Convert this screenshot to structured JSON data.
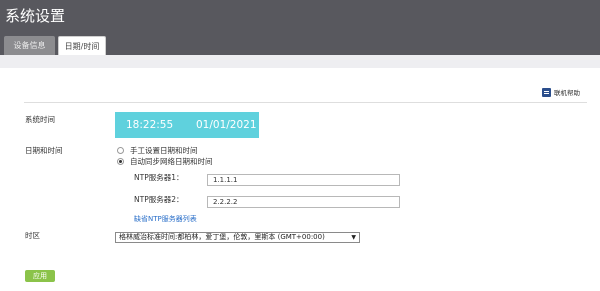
{
  "app": {
    "title": "系统设置"
  },
  "tabs": [
    {
      "label": "设备信息",
      "active": false
    },
    {
      "label": "日期/时间",
      "active": true
    }
  ],
  "help": {
    "label": "联机帮助",
    "icon": "help-book-icon"
  },
  "system_time": {
    "label": "系统时间",
    "time": "18:22:55",
    "date": "01/01/2021"
  },
  "datetime": {
    "label": "日期和时间",
    "options": [
      {
        "label": "手工设置日期和时间",
        "checked": false
      },
      {
        "label": "自动同步网络日期和时间",
        "checked": true
      }
    ],
    "ntp1": {
      "label": "NTP服务器1：",
      "value": "1.1.1.1"
    },
    "ntp2": {
      "label": "NTP服务器2：",
      "value": "2.2.2.2"
    },
    "default_list_link": "缺省NTP服务器列表"
  },
  "timezone": {
    "label": "时区",
    "selected": "格林威治标准时间:都柏林，爱丁堡，伦敦，里斯本 (GMT+00:00)"
  },
  "apply_label": "应用",
  "colors": {
    "topbar": "#58585e",
    "clock_box": "#5fd1dd",
    "apply": "#8bc34a",
    "link": "#2a6fc9"
  }
}
